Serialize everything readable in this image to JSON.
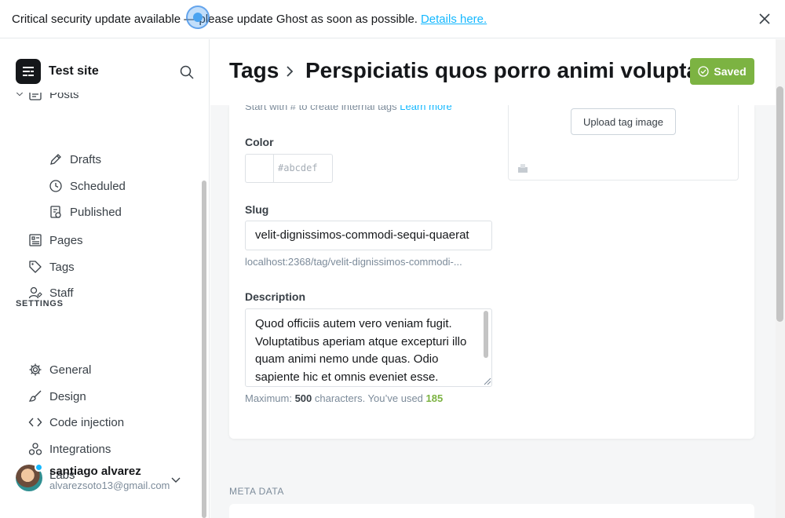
{
  "banner": {
    "text": "Critical security update available — please update Ghost as soon as possible.",
    "link": "Details here."
  },
  "sidebar": {
    "site_name": "Test site",
    "items": [
      {
        "label": "Posts",
        "icon": "posts-icon"
      },
      {
        "label": "Drafts",
        "icon": "pencil-icon"
      },
      {
        "label": "Scheduled",
        "icon": "clock-icon"
      },
      {
        "label": "Published",
        "icon": "published-icon"
      },
      {
        "label": "Pages",
        "icon": "pages-icon"
      },
      {
        "label": "Tags",
        "icon": "tag-icon"
      },
      {
        "label": "Staff",
        "icon": "staff-icon"
      }
    ],
    "settings_label": "SETTINGS",
    "settings": [
      {
        "label": "General",
        "icon": "gear-icon"
      },
      {
        "label": "Design",
        "icon": "brush-icon"
      },
      {
        "label": "Code injection",
        "icon": "code-icon"
      },
      {
        "label": "Integrations",
        "icon": "integrations-icon"
      },
      {
        "label": "Labs",
        "icon": "flask-icon"
      }
    ],
    "user": {
      "name": "santiago alvarez",
      "email": "alvarezsoto13@gmail.com"
    }
  },
  "header": {
    "crumb": "Tags",
    "title": "Perspiciatis quos porro animi voluptate",
    "saved_label": "Saved"
  },
  "form": {
    "hint": "Start with # to create internal tags",
    "hint_link": "Learn more",
    "upload_label": "Upload tag image",
    "color_label": "Color",
    "color_placeholder": "#abcdef",
    "slug_label": "Slug",
    "slug_value": "velit-dignissimos-commodi-sequi-quaerat",
    "slug_url": "localhost:2368/tag/velit-dignissimos-commodi-...",
    "description_label": "Description",
    "description_value": "Quod officiis autem vero veniam fugit. Voluptatibus aperiam atque excepturi illo quam animi nemo unde quas. Odio sapiente hic et omnis eveniet esse.",
    "counter_prefix": "Maximum: ",
    "counter_max": "500",
    "counter_middle": " characters. You’ve used ",
    "counter_used": "185"
  },
  "meta_label": "META DATA",
  "colors": {
    "accent": "#14b8ff",
    "saved": "#7cb342",
    "text": "#15171a"
  }
}
